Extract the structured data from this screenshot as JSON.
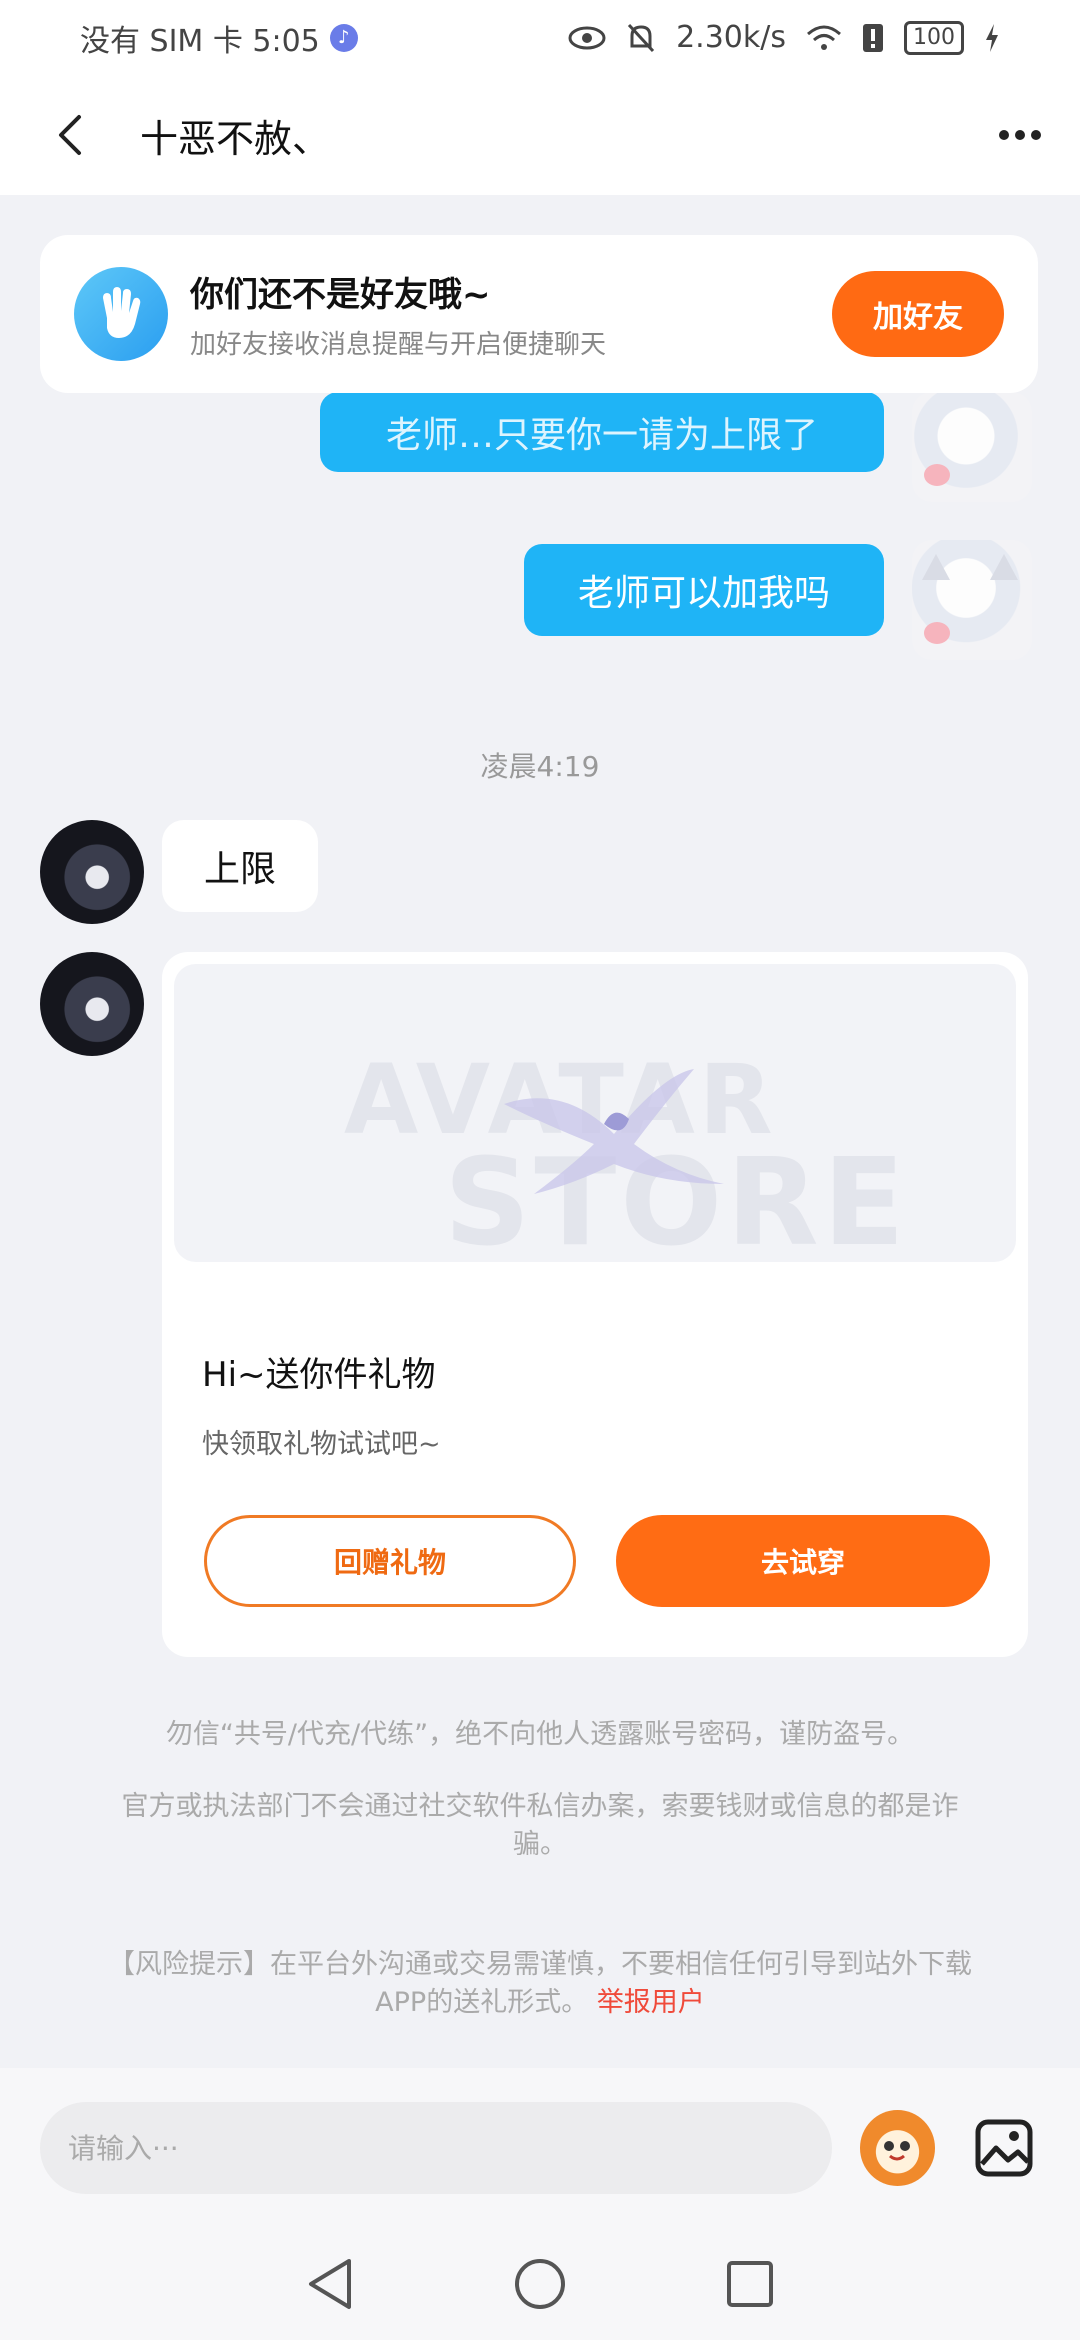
{
  "status_bar": {
    "carrier_time": "没有 SIM 卡 5:05",
    "speed": "2.30k/s",
    "battery": "100",
    "music_icon": "music-note-icon",
    "eye_icon": "eye-icon",
    "mute_icon": "bell-off-icon",
    "wifi_icon": "wifi-icon",
    "charging_icon": "bolt-icon"
  },
  "header": {
    "title": "十恶不赦、",
    "back_icon": "chevron-left-icon",
    "more_icon": "more-dots-icon"
  },
  "friend_banner": {
    "title": "你们还不是好友哦~",
    "subtitle": "加好友接收消息提醒与开启便捷聊天",
    "button": "加好友",
    "icon": "hand-wave-icon"
  },
  "messages": {
    "outgoing_partial": "老师…只要你一请为上限了",
    "outgoing_2": "老师可以加我吗",
    "timestamp": "凌晨4:19",
    "incoming_1": "上限"
  },
  "gift_card": {
    "image_watermark_1": "AVATAR",
    "image_watermark_2": "STORE",
    "title": "Hi~送你件礼物",
    "subtitle": "快领取礼物试试吧~",
    "return_button": "回赠礼物",
    "try_button": "去试穿"
  },
  "notices": {
    "notice_1": "勿信“共号/代充/代练”，绝不向他人透露账号密码，谨防盗号。",
    "notice_2": "官方或执法部门不会通过社交软件私信办案，索要钱财或信息的都是诈骗。",
    "notice_3": "【风险提示】在平台外沟通或交易需谨慎，不要相信任何引导到站外下载APP的送礼形式。",
    "report_link": "举报用户"
  },
  "input_bar": {
    "placeholder": "请输入···",
    "emoji_icon": "emoji-mascot-icon",
    "image_icon": "image-icon"
  },
  "colors": {
    "accent_orange": "#ff6a13",
    "bubble_blue": "#1fb4f6",
    "report_red": "#f04a3a"
  }
}
